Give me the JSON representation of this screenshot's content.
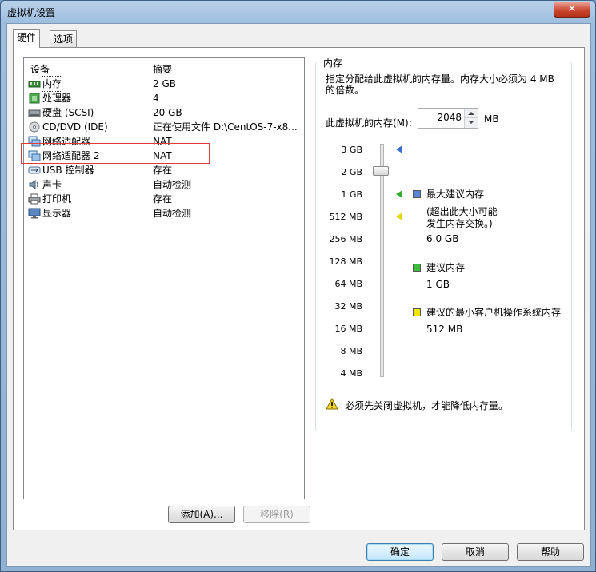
{
  "window": {
    "title": "虚拟机设置"
  },
  "tabs": [
    {
      "label": "硬件",
      "active": true
    },
    {
      "label": "选项",
      "active": false
    }
  ],
  "devices": {
    "header": {
      "device": "设备",
      "summary": "摘要"
    },
    "rows": [
      {
        "name": "内存",
        "summary": "2 GB",
        "icon": "memory-icon"
      },
      {
        "name": "处理器",
        "summary": "4",
        "icon": "processor-icon"
      },
      {
        "name": "硬盘 (SCSI)",
        "summary": "20 GB",
        "icon": "hard-disk-icon"
      },
      {
        "name": "CD/DVD (IDE)",
        "summary": "正在使用文件 D:\\CentOS-7-x8...",
        "icon": "cd-dvd-icon"
      },
      {
        "name": "网络适配器",
        "summary": "NAT",
        "icon": "network-adapter-icon"
      },
      {
        "name": "网络适配器 2",
        "summary": "NAT",
        "icon": "network-adapter-icon"
      },
      {
        "name": "USB 控制器",
        "summary": "存在",
        "icon": "usb-icon"
      },
      {
        "name": "声卡",
        "summary": "自动检测",
        "icon": "sound-card-icon"
      },
      {
        "name": "打印机",
        "summary": "存在",
        "icon": "printer-icon"
      },
      {
        "name": "显示器",
        "summary": "自动检测",
        "icon": "display-icon"
      }
    ],
    "add_button": "添加(A)...",
    "remove_button": "移除(R)"
  },
  "memory": {
    "group_title": "内存",
    "description": "指定分配给此虚拟机的内存量。内存大小必须为 4 MB 的倍数。",
    "field_label": "此虚拟机的内存(M):",
    "value": "2048",
    "unit": "MB",
    "ticks": [
      "3 GB",
      "2 GB",
      "1 GB",
      "512 MB",
      "256 MB",
      "128 MB",
      "64 MB",
      "32 MB",
      "16 MB",
      "8 MB",
      "4 MB"
    ],
    "legend": {
      "max_label": "最大建议内存",
      "max_note_1": "(超出此大小可能",
      "max_note_2": "发生内存交换。)",
      "max_value": "6.0 GB",
      "recommended_label": "建议内存",
      "recommended_value": "1 GB",
      "min_label": "建议的最小客户机操作系统内存",
      "min_value": "512 MB"
    },
    "colors": {
      "max": "#3b6fcf",
      "recommended": "#2fae2f",
      "min": "#e4d600"
    },
    "warning": "必须先关闭虚拟机，才能降低内存量。"
  },
  "footer": {
    "ok": "确定",
    "cancel": "取消",
    "help": "帮助"
  }
}
